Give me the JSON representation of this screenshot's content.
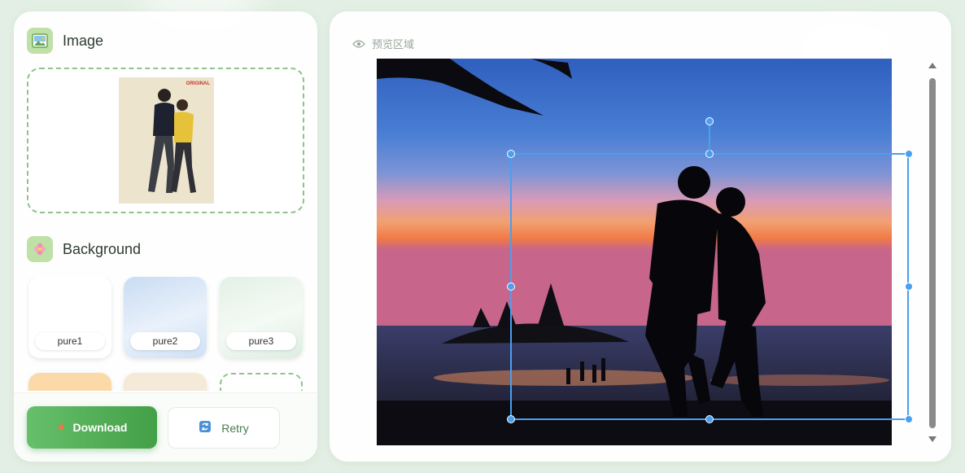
{
  "image_section": {
    "title": "Image",
    "thumb_badge": "ORIGINAL"
  },
  "background_section": {
    "title": "Background",
    "tiles": [
      {
        "label": "pure1"
      },
      {
        "label": "pure2"
      },
      {
        "label": "pure3"
      }
    ]
  },
  "actions": {
    "download_label": "Download",
    "retry_label": "Retry"
  },
  "preview": {
    "label": "预览区域"
  },
  "colors": {
    "accent_green": "#43a047",
    "selection_blue": "#4a9ff0",
    "icon_bg": "#bfe0a6"
  },
  "icons": {
    "image_section": "image-icon",
    "background_section": "flower-icon",
    "download": "fire-icon",
    "retry": "retry-icon",
    "preview": "eye-icon"
  }
}
